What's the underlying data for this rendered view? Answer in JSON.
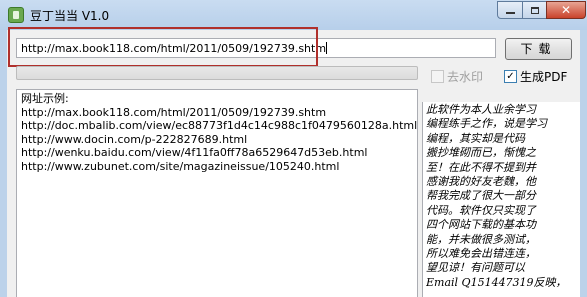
{
  "window": {
    "title": "豆丁当当  V1.0"
  },
  "url_input": {
    "value": "http://max.book118.com/html/2011/0509/192739.shtm"
  },
  "download_button": {
    "label": "下载"
  },
  "progress": {
    "fraction": 0
  },
  "checkboxes": {
    "watermark": {
      "label": "去水印",
      "checked": false,
      "enabled": false
    },
    "pdf": {
      "label": "生成PDF",
      "checked": true,
      "enabled": true
    }
  },
  "examples": {
    "heading": "网址示例:",
    "lines": [
      "http://max.book118.com/html/2011/0509/192739.shtm",
      "http://doc.mbalib.com/view/ec88773f1d4c14c988c1f0479560128a.html",
      "http://www.docin.com/p-222827689.html",
      "http://wenku.baidu.com/view/4f11fa0ff78a6529647d53eb.html",
      "http://www.zubunet.com/site/magazineissue/105240.html"
    ]
  },
  "notes": {
    "lines": [
      "此软件为本人业余学习",
      "编程练手之作，说是学习",
      "编程，其实却是代码",
      "搬抄堆砌而已，惭愧之",
      "至！在此不得不提到并",
      "感谢我的好友老魏，他",
      "帮我完成了很大一部分",
      "代码。软件仅只实现了",
      "四个网站下载的基本功",
      "能，并未做很多测试，",
      "所以难免会出错连连，",
      "望见谅！有问题可以",
      "Email Q151447319反映，"
    ]
  },
  "colors": {
    "highlight_box": "#b0302c",
    "progress_fill": "#06b025"
  }
}
